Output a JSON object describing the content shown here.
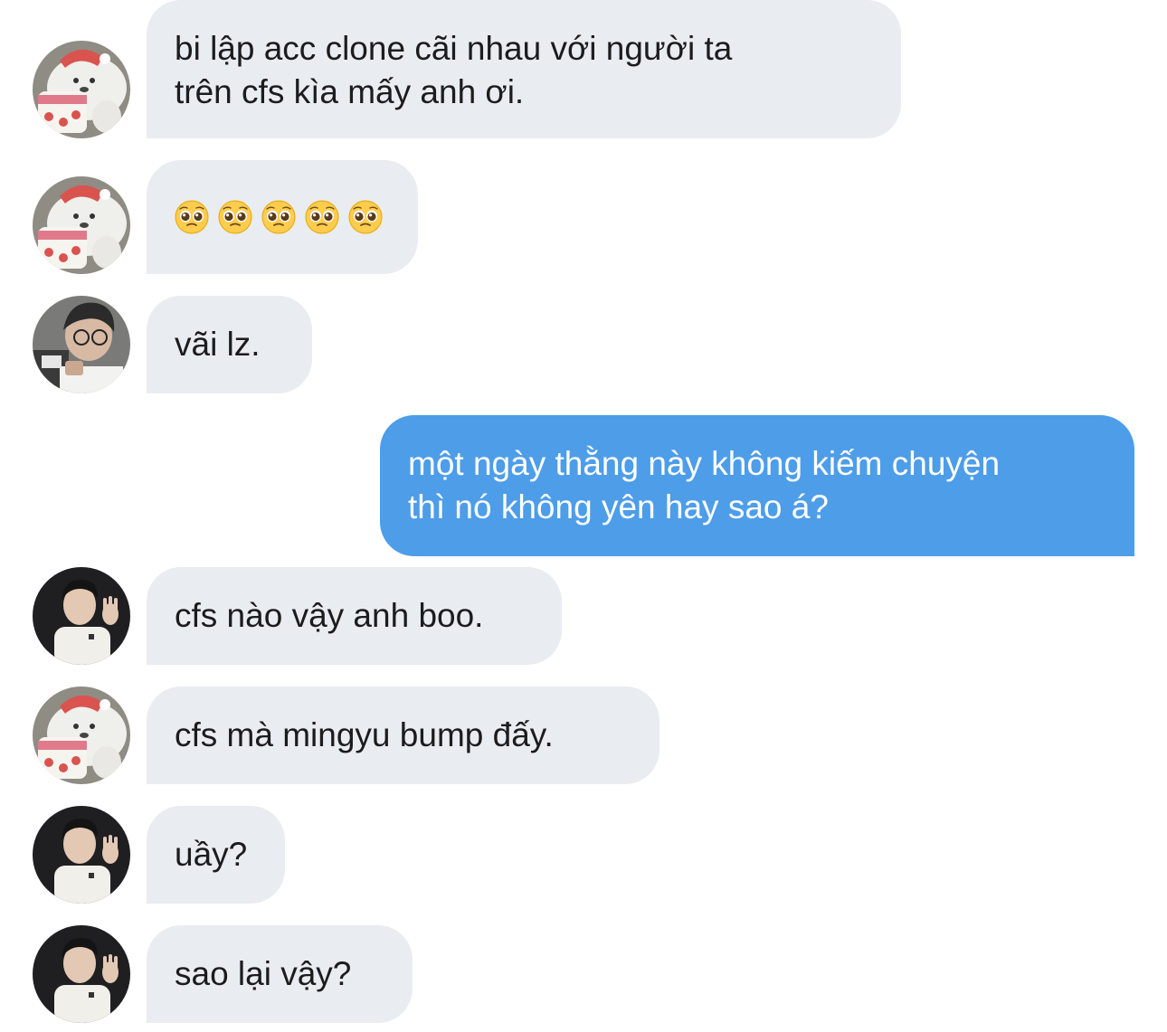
{
  "messages": [
    {
      "sender": "bear",
      "side": "left",
      "lines": [
        "bi lập acc clone cãi nhau với người ta",
        "trên cfs kìa mấy anh ơi."
      ]
    },
    {
      "sender": "bear",
      "side": "left",
      "emoji": [
        "pleading-face",
        "pleading-face",
        "pleading-face",
        "pleading-face",
        "pleading-face"
      ]
    },
    {
      "sender": "boy-glasses",
      "side": "left",
      "lines": [
        "vãi lz."
      ]
    },
    {
      "sender": "me",
      "side": "right",
      "lines": [
        "một ngày thằng này không kiếm chuyện",
        "thì nó không yên hay sao á?"
      ]
    },
    {
      "sender": "man-white-shirt",
      "side": "left",
      "lines": [
        "cfs nào vậy anh boo."
      ]
    },
    {
      "sender": "bear",
      "side": "left",
      "lines": [
        "cfs mà mingyu bump đấy."
      ]
    },
    {
      "sender": "man-white-shirt",
      "side": "left",
      "lines": [
        "uầy?"
      ]
    },
    {
      "sender": "man-white-shirt",
      "side": "left",
      "lines": [
        "sao lại vậy?"
      ]
    }
  ],
  "colors": {
    "incoming_bubble": "#e9ecf0",
    "outgoing_bubble": "#4d9de9",
    "incoming_text": "#1c1c1e",
    "outgoing_text": "#ffffff"
  }
}
